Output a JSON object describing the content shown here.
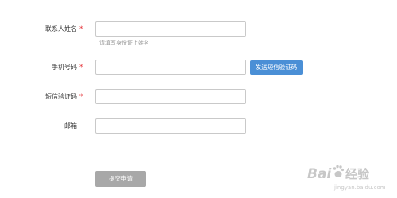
{
  "form": {
    "fields": [
      {
        "label": "联系人姓名",
        "required": "*",
        "value": "",
        "hint": "请填写身份证上姓名"
      },
      {
        "label": "手机号码",
        "required": "*",
        "value": ""
      },
      {
        "label": "短信验证码",
        "required": "*",
        "value": ""
      },
      {
        "label": "邮箱",
        "value": ""
      }
    ],
    "send_sms_label": "发送短信验证码",
    "submit_label": "提交申请"
  },
  "watermark": {
    "text": "Baidu经验",
    "url": "jingyan.baidu.com"
  },
  "colors": {
    "required_star": "#e5353a",
    "sms_button": "#4a8fd6",
    "submit_button": "#a8a8a8",
    "input_border": "#c9c9c9",
    "hint_text": "#999999"
  }
}
